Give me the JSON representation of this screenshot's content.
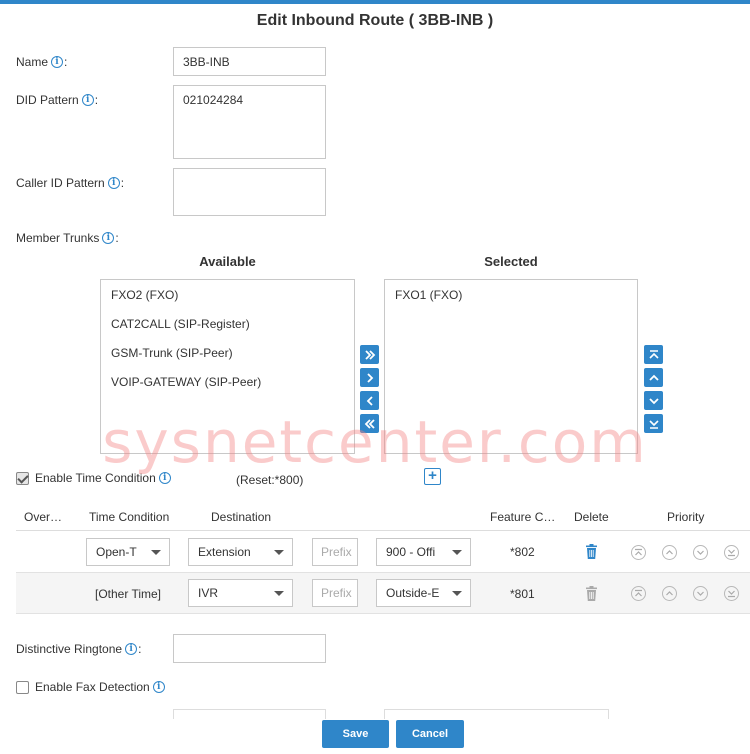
{
  "title": "Edit Inbound Route ( 3BB-INB )",
  "form": {
    "name_label": "Name",
    "name_value": "3BB-INB",
    "did_label": "DID Pattern",
    "did_value": "021024284",
    "callerid_label": "Caller ID Pattern",
    "callerid_value": "",
    "trunks_label": "Member Trunks",
    "distinctive_label": "Distinctive Ringtone",
    "distinctive_value": "",
    "fax_label": "Enable Fax Detection",
    "fax_checked": false
  },
  "trunks": {
    "available_heading": "Available",
    "selected_heading": "Selected",
    "available": [
      "FXO2 (FXO)",
      "CAT2CALL (SIP-Register)",
      "GSM-Trunk (SIP-Peer)",
      "VOIP-GATEWAY (SIP-Peer)"
    ],
    "selected": [
      "FXO1 (FXO)"
    ],
    "move_buttons": [
      "move-all-right",
      "move-right",
      "move-left",
      "move-all-left"
    ],
    "order_buttons": [
      "move-top",
      "move-up",
      "move-down",
      "move-bottom"
    ]
  },
  "time_condition": {
    "enable_label": "Enable Time Condition",
    "enabled": true,
    "reset_text": "(Reset:*800)",
    "columns": [
      "Over…",
      "Time Condition",
      "Destination",
      "Feature C…",
      "Delete",
      "Priority"
    ],
    "rows": [
      {
        "time_condition": "Open-T",
        "dest_type": "Extension",
        "prefix_placeholder": "Prefix",
        "destination": "900 - Offi",
        "feature_code": "*802",
        "deletable": true
      },
      {
        "time_condition": "[Other Time]",
        "dest_type": "IVR",
        "prefix_placeholder": "Prefix",
        "destination": "Outside-E",
        "feature_code": "*801",
        "deletable": false
      }
    ]
  },
  "watermark": "sysnetcenter.com",
  "buttons": {
    "save": "Save",
    "cancel": "Cancel"
  },
  "colors": {
    "accent": "#2f86c9",
    "watermark": "#f48282"
  }
}
